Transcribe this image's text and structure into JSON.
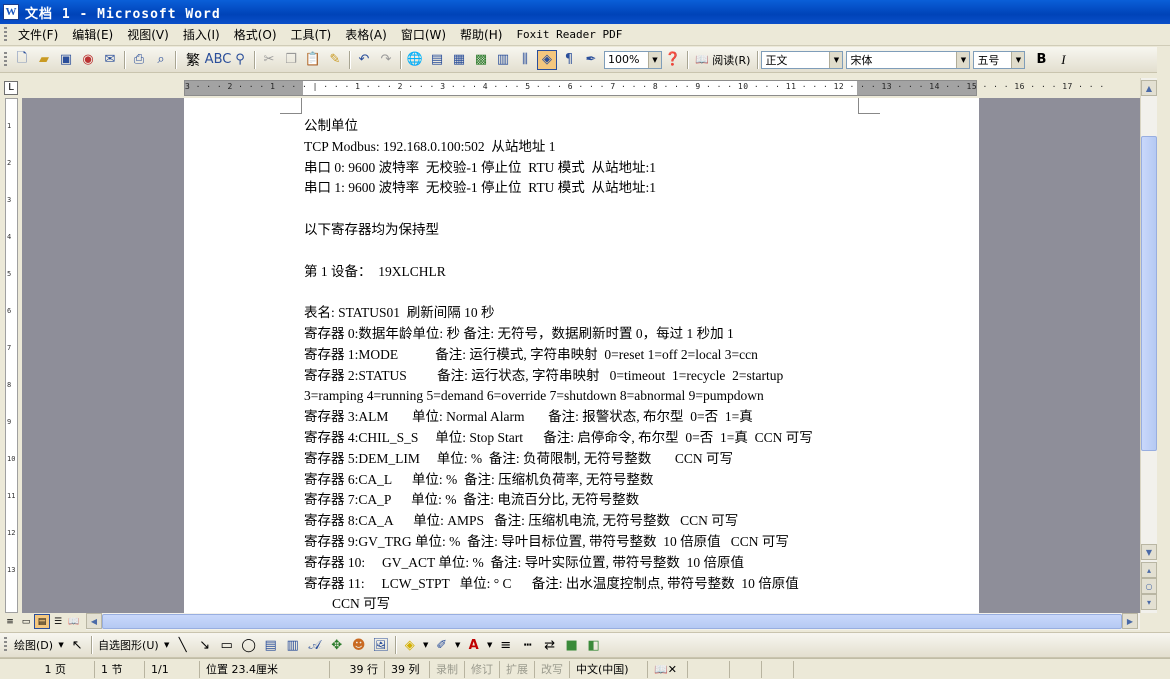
{
  "window": {
    "title": "文档 1 - Microsoft Word",
    "app_icon_letter": "W"
  },
  "menu": {
    "items": [
      "文件(F)",
      "编辑(E)",
      "视图(V)",
      "插入(I)",
      "格式(O)",
      "工具(T)",
      "表格(A)",
      "窗口(W)",
      "帮助(H)",
      "Foxit Reader PDF"
    ]
  },
  "toolbar": {
    "zoom": "100%",
    "read_label": "阅读(R)",
    "style": "正文",
    "font": "宋体",
    "size": "五号",
    "bold": "B",
    "italic": "I",
    "traditional_label": "繁"
  },
  "ruler": {
    "numbers": "3 · · · 2 · · · 1 · · · | · · · 1 · · · 2 · · · 3 · · · 4 · · · 5 · · · 6 · · · 7 · · · 8 · · · 9 · · · 10 · · · 11 · · · 12 · · · 13 · · · 14 · · 15 · · · 16 · · · 17 · · ·"
  },
  "vruler": {
    "ticks": [
      "1",
      "2",
      "3",
      "4",
      "5",
      "6",
      "7",
      "8",
      "9",
      "10",
      "11",
      "12",
      "13"
    ]
  },
  "document": {
    "lines": [
      {
        "text": "公制单位"
      },
      {
        "text": "TCP Modbus: 192.168.0.100:502  从站地址 1"
      },
      {
        "text": "串口 0: 9600 波特率  无校验-1 停止位  RTU 模式  从站地址:1"
      },
      {
        "text": "串口 1: 9600 波特率  无校验-1 停止位  RTU 模式  从站地址:1"
      },
      {
        "text": ""
      },
      {
        "text": "以下寄存器均为保持型"
      },
      {
        "text": ""
      },
      {
        "text": "第 1 设备：  19XLCHLR"
      },
      {
        "text": ""
      },
      {
        "text": "表名: STATUS01  刷新间隔 10 秒"
      },
      {
        "text": "寄存器 0:数据年龄单位: 秒 备注: 无符号，数据刷新时置 0，每过 1 秒加 1"
      },
      {
        "text": "寄存器 1:MODE           备注: 运行模式, 字符串映射  0=reset 1=off 2=local 3=ccn"
      },
      {
        "text": "寄存器 2:STATUS         备注: 运行状态, 字符串映射   0=timeout  1=recycle  2=startup"
      },
      {
        "text": "3=ramping 4=running 5=demand 6=override 7=shutdown 8=abnormal 9=pumpdown"
      },
      {
        "text": "寄存器 3:ALM       单位: Normal Alarm       备注: 报警状态, 布尔型  0=否  1=真"
      },
      {
        "text": "寄存器 4:CHIL_S_S     单位: Stop Start      备注: 启停命令, 布尔型  0=否  1=真  CCN 可写"
      },
      {
        "text": "寄存器 5:DEM_LIM     单位: %  备注: 负荷限制, 无符号整数       CCN 可写"
      },
      {
        "text": "寄存器 6:CA_L      单位: %  备注: 压缩机负荷率, 无符号整数"
      },
      {
        "text": "寄存器 7:CA_P      单位: %  备注: 电流百分比, 无符号整数"
      },
      {
        "text": "寄存器 8:CA_A      单位: AMPS   备注: 压缩机电流, 无符号整数   CCN 可写"
      },
      {
        "text": "寄存器 9:GV_TRG 单位: %  备注: 导叶目标位置, 带符号整数  10 倍原值   CCN 可写"
      },
      {
        "text": "寄存器 10:     GV_ACT 单位: %  备注: 导叶实际位置, 带符号整数  10 倍原值"
      },
      {
        "text": "寄存器 11:     LCW_STPT   单位: ° C      备注: 出水温度控制点, 带符号整数  10 倍原值"
      },
      {
        "text": "CCN 可写",
        "indent": true
      }
    ]
  },
  "drawing_toolbar": {
    "draw_label": "绘图(D)",
    "autoshape_label": "自选图形(U)"
  },
  "status": {
    "page": "1 页",
    "section": "1 节",
    "pages": "1/1",
    "position": "位置 23.4厘米",
    "line": "39 行",
    "column": "39 列",
    "rec": "录制",
    "trk": "修订",
    "ext": "扩展",
    "ovr": "改写",
    "language": "中文(中国)"
  }
}
